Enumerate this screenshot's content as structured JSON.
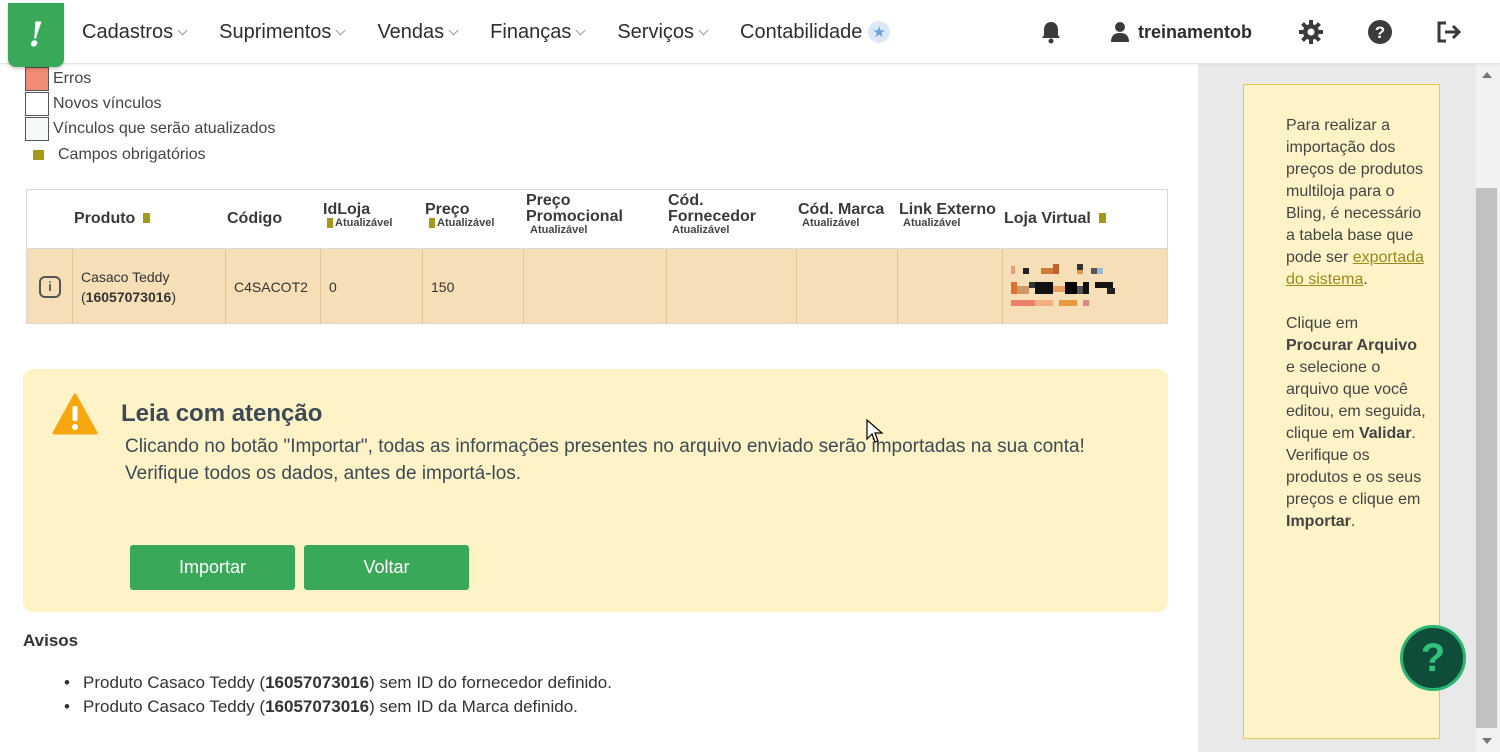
{
  "app": {
    "logo_letter": "!",
    "brand_color": "#3aa859"
  },
  "nav": {
    "menu": [
      {
        "label": "Cadastros"
      },
      {
        "label": "Suprimentos"
      },
      {
        "label": "Vendas"
      },
      {
        "label": "Finanças"
      },
      {
        "label": "Serviços"
      },
      {
        "label": "Contabilidade"
      }
    ],
    "user_name": "treinamentob"
  },
  "legend": {
    "errors": "Erros",
    "new_links": "Novos vínculos",
    "updated_links": "Vínculos que serão atualizados",
    "required": "Campos obrigatórios",
    "errors_color": "#f28b74"
  },
  "table": {
    "headers": {
      "produto": "Produto",
      "codigo": "Código",
      "idloja": "IdLoja",
      "preco": "Preço",
      "preco_promocional_1": "Preço",
      "preco_promocional_2": "Promocional",
      "cod_fornecedor_1": "Cód.",
      "cod_fornecedor_2": "Fornecedor",
      "cod_marca": "Cód. Marca",
      "link_externo": "Link Externo",
      "loja_virtual": "Loja Virtual",
      "atualizavel": "Atualizável"
    },
    "row": {
      "product_name": "Casaco Teddy",
      "product_id_open": "(",
      "product_id": "16057073016",
      "product_id_close": ")",
      "codigo": "C4SACOT2",
      "idloja": "0",
      "preco": "150",
      "preco_promocional": "",
      "cod_fornecedor": "",
      "cod_marca": "",
      "link_externo": ""
    }
  },
  "warning": {
    "title": "Leia com atenção",
    "line1": "Clicando no botão \"Importar\", todas as informações presentes no arquivo enviado serão importadas na sua conta!",
    "line2": "Verifique todos os dados, antes de importá-los.",
    "import_label": "Importar",
    "back_label": "Voltar"
  },
  "avisos": {
    "title": "Avisos",
    "items": [
      {
        "prefix": "Produto Casaco Teddy (",
        "id": "16057073016",
        "suffix": ") sem ID do fornecedor definido."
      },
      {
        "prefix": "Produto Casaco Teddy (",
        "id": "16057073016",
        "suffix": ") sem ID da Marca definido."
      }
    ]
  },
  "help": {
    "p1a": "Para realizar a importação dos preços de produtos multiloja para o Bling, é necessário a tabela base que pode ser",
    "p1_link": "exportada do sistema",
    "p1b": ".",
    "p2a": "Clique em",
    "p2_b1": "Procurar Arquivo",
    "p2b": "e selecione o arquivo que você editou, em seguida, clique em",
    "p2_b2": "Validar",
    "p2c": ". Verifique os produtos e os seus preços e clique em",
    "p2_b3": "Importar",
    "p2d": "."
  },
  "fab_label": "?"
}
